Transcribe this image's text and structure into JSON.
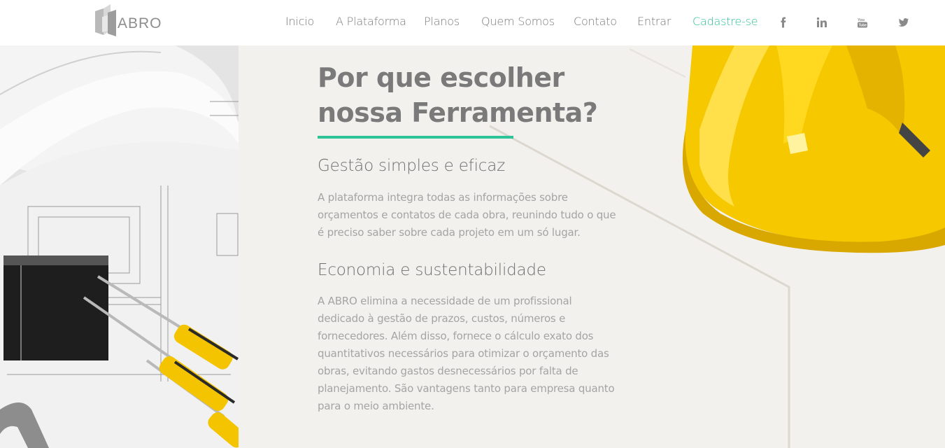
{
  "logo": {
    "text": "ABRO"
  },
  "nav": {
    "items": [
      {
        "label": "Inicio"
      },
      {
        "label": "A Plataforma"
      },
      {
        "label": "Planos"
      },
      {
        "label": "Quem Somos"
      },
      {
        "label": "Contato"
      },
      {
        "label": "Entrar"
      },
      {
        "label": "Cadastre-se"
      }
    ],
    "social": [
      "facebook-icon",
      "linkedin-icon",
      "youtube-icon",
      "twitter-icon"
    ]
  },
  "section": {
    "title_line1": "Por que escolher",
    "title_line2": "nossa Ferramenta?",
    "features": [
      {
        "heading": "Gestão simples e eficaz",
        "lines": [
          "A plataforma integra todas as informações sobre",
          "orçamentos e contatos de cada obra, reunindo tudo o que",
          "é preciso saber sobre cada projeto em um só lugar."
        ]
      },
      {
        "heading": "Economia e sustentabilidade",
        "lines": [
          "A ABRO elimina a necessidade de um profissional",
          "dedicado à gestão de prazos, custos, números e",
          "fornecedores. Além disso, fornece o cálculo exato dos",
          "quantitativos necessários para otimizar o orçamento das",
          "obras, evitando gastos desnecessários por falta de",
          "planejamento. São vantagens tanto para empresa quanto",
          "para o meio ambiente."
        ]
      }
    ]
  },
  "colors": {
    "accent": "#2fc398",
    "text": "#7a7a7a",
    "background": "#f3f1ed",
    "helmet": "#f5c800"
  }
}
